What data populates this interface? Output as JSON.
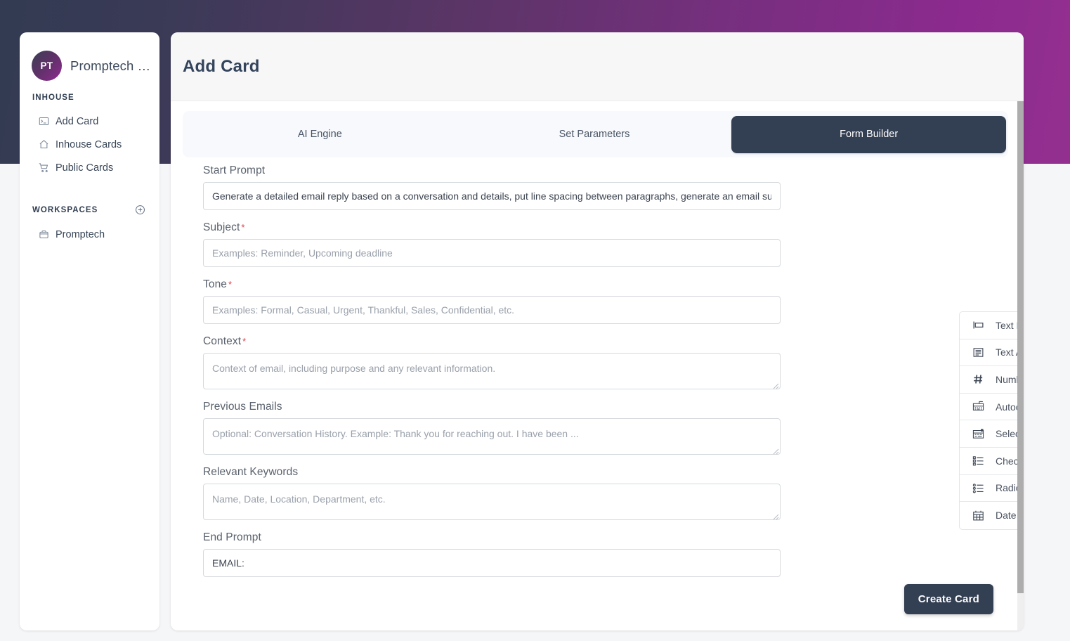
{
  "app": {
    "workspace_initials": "PT",
    "workspace_name": "Promptech …"
  },
  "sidebar": {
    "section_inhouse": "INHOUSE",
    "section_workspaces": "WORKSPACES",
    "add_workspace_icon": "plus-circle-icon",
    "inhouse_items": [
      {
        "label": "Add Card",
        "icon": "terminal-icon"
      },
      {
        "label": "Inhouse Cards",
        "icon": "home-icon"
      },
      {
        "label": "Public Cards",
        "icon": "shopping-cart-icon"
      }
    ],
    "workspace_items": [
      {
        "label": "Promptech",
        "icon": "briefcase-icon"
      }
    ]
  },
  "header": {
    "title": "Add Card"
  },
  "tabs": [
    {
      "label": "AI Engine",
      "active": false
    },
    {
      "label": "Set Parameters",
      "active": false
    },
    {
      "label": "Form Builder",
      "active": true
    }
  ],
  "form": {
    "fields": [
      {
        "label": "Start Prompt",
        "required": false,
        "type": "text",
        "value": "Generate a detailed email reply based on a conversation and details, put line spacing between paragraphs, generate an email sub",
        "placeholder": ""
      },
      {
        "label": "Subject",
        "required": true,
        "type": "text",
        "value": "",
        "placeholder": "Examples: Reminder, Upcoming deadline"
      },
      {
        "label": "Tone",
        "required": true,
        "type": "text",
        "value": "",
        "placeholder": "Examples: Formal, Casual, Urgent, Thankful, Sales, Confidential, etc."
      },
      {
        "label": "Context",
        "required": true,
        "type": "textarea",
        "value": "",
        "placeholder": "Context of email, including purpose and any relevant information."
      },
      {
        "label": "Previous Emails",
        "required": false,
        "type": "textarea",
        "value": "",
        "placeholder": "Optional: Conversation History. Example: Thank you for reaching out. I have been ..."
      },
      {
        "label": "Relevant Keywords",
        "required": false,
        "type": "textarea",
        "value": "",
        "placeholder": "Name, Date, Location, Department, etc."
      },
      {
        "label": "End Prompt",
        "required": false,
        "type": "text",
        "value": "EMAIL:",
        "placeholder": ""
      }
    ],
    "required_marker": "*"
  },
  "palette": {
    "items": [
      {
        "label": "Text Field",
        "icon": "text-field-icon"
      },
      {
        "label": "Text Area",
        "icon": "text-area-icon"
      },
      {
        "label": "Number",
        "icon": "hash-icon"
      },
      {
        "label": "Autocomplete",
        "icon": "autocomplete-icon"
      },
      {
        "label": "Select",
        "icon": "select-icon"
      },
      {
        "label": "Checkbox Group",
        "icon": "checkbox-list-icon"
      },
      {
        "label": "Radio Group",
        "icon": "radio-list-icon"
      },
      {
        "label": "Date Field",
        "icon": "calendar-icon"
      }
    ]
  },
  "actions": {
    "create_card": "Create Card"
  },
  "colors": {
    "gradient_start": "#323b52",
    "gradient_end": "#93308f",
    "accent_dark": "#333f52",
    "required_red": "#e0454f",
    "page_bg": "#f5f6f8"
  }
}
